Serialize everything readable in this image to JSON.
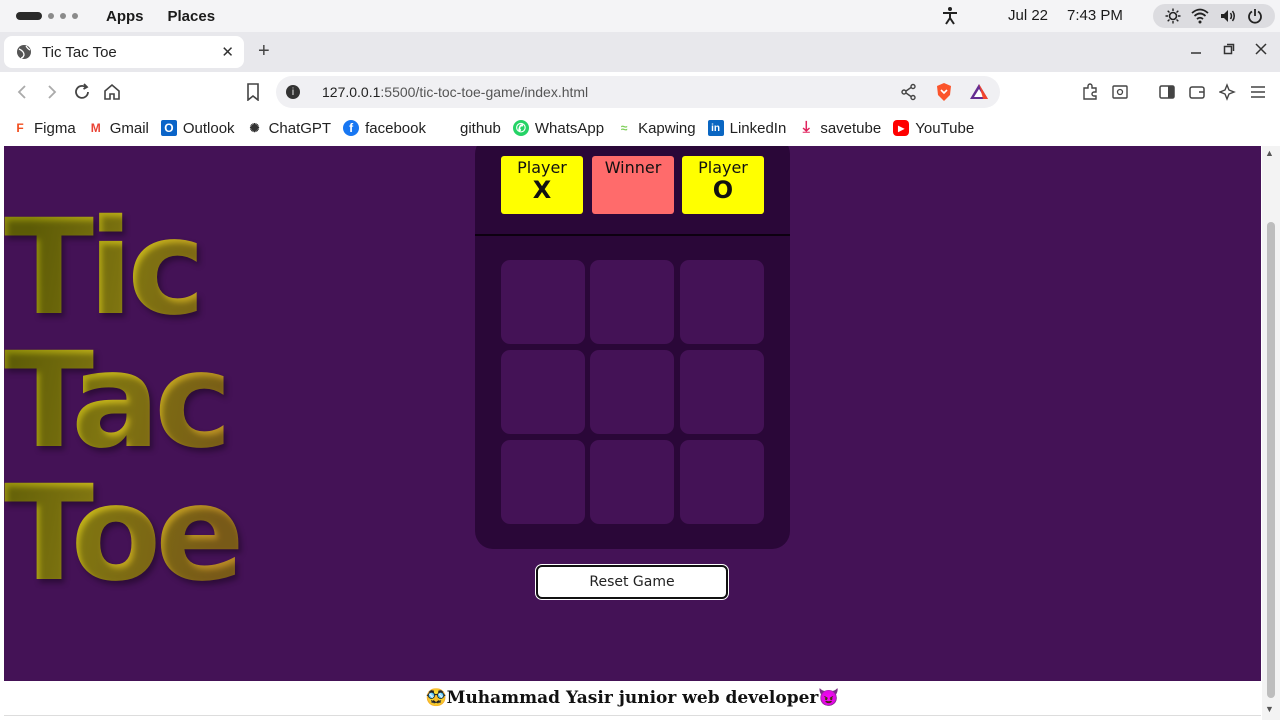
{
  "os": {
    "menu_apps": "Apps",
    "menu_places": "Places",
    "date": "Jul 22",
    "time": "7:43 PM"
  },
  "browser": {
    "tab_title": "Tic Tac Toe",
    "tab_close": "✕",
    "new_tab": "+",
    "url_host": "127.0.0.1",
    "url_path": ":5500/tic-toc-toe-game/index.html",
    "info_glyph": "i"
  },
  "bookmarks": [
    {
      "label": "Figma",
      "icon": "figma-icon",
      "color": "#f24e1e",
      "glyph": "F"
    },
    {
      "label": "Gmail",
      "icon": "gmail-icon",
      "color": "#ea4335",
      "glyph": "M"
    },
    {
      "label": "Outlook",
      "icon": "outlook-icon",
      "color": "#0a64c8",
      "glyph": "O"
    },
    {
      "label": "ChatGPT",
      "icon": "chatgpt-icon",
      "color": "#333333",
      "glyph": "✺"
    },
    {
      "label": "facebook",
      "icon": "facebook-icon",
      "color": "#1877f2",
      "glyph": "f"
    },
    {
      "label": "github",
      "icon": "github-icon",
      "color": "#ffffff",
      "glyph": ""
    },
    {
      "label": "WhatsApp",
      "icon": "whatsapp-icon",
      "color": "#25d366",
      "glyph": "✆"
    },
    {
      "label": "Kapwing",
      "icon": "kapwing-icon",
      "color": "#7fcf5a",
      "glyph": "≈"
    },
    {
      "label": "LinkedIn",
      "icon": "linkedin-icon",
      "color": "#0a66c2",
      "glyph": "in"
    },
    {
      "label": "savetube",
      "icon": "download-icon",
      "color": "#e0245e",
      "glyph": "⤓"
    },
    {
      "label": "YouTube",
      "icon": "youtube-icon",
      "color": "#ff0000",
      "glyph": "▶"
    }
  ],
  "game": {
    "title_lines": [
      "Tic",
      "Tac",
      "Toe"
    ],
    "player_x": {
      "label": "Player",
      "symbol": "X"
    },
    "winner": {
      "label": "Winner",
      "symbol": ""
    },
    "player_o": {
      "label": "Player",
      "symbol": "O"
    },
    "cells": [
      "",
      "",
      "",
      "",
      "",
      "",
      "",
      "",
      ""
    ],
    "reset_label": "Reset Game"
  },
  "footer": {
    "text": "🥸Muhammad Yasir junior web developer😈"
  },
  "colors": {
    "page_bg": "#441256",
    "panel_bg": "#2a0738",
    "player_chip": "#ffff00",
    "winner_chip": "#ff6b6b"
  }
}
